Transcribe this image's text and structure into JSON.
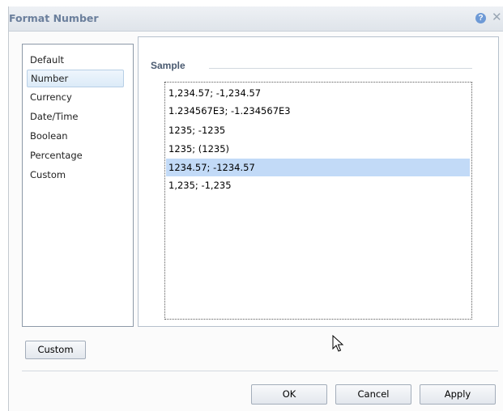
{
  "dialog": {
    "title": "Format Number",
    "help_icon": "help-icon",
    "close_icon": "close-icon",
    "accent_color": "#6b7f9c"
  },
  "categories": {
    "items": [
      "Default",
      "Number",
      "Currency",
      "Date/Time",
      "Boolean",
      "Percentage",
      "Custom"
    ],
    "selected": "Number"
  },
  "sample": {
    "label": "Sample",
    "items": [
      "1,234.57; -1,234.57",
      "1.234567E3; -1.234567E3",
      "1235; -1235",
      "1235; (1235)",
      "1234.57; -1234.57",
      "1,235; -1,235"
    ],
    "selected": "1234.57; -1234.57",
    "selection_color": "#c2daf7"
  },
  "buttons": {
    "custom": "Custom",
    "ok": "OK",
    "cancel": "Cancel",
    "apply": "Apply"
  }
}
